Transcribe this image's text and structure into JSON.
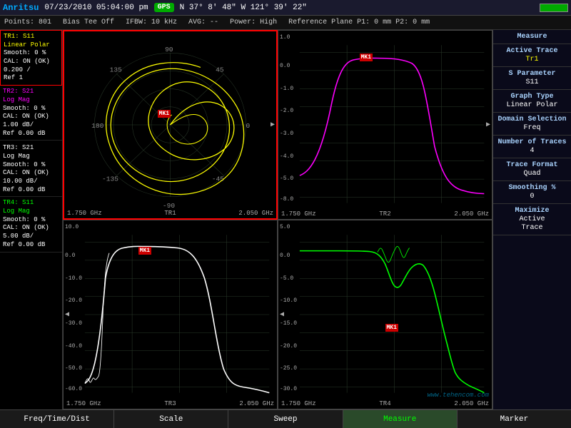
{
  "header": {
    "logo": "Anritsu",
    "datetime": "07/23/2010  05:04:00 pm",
    "gps": "GPS",
    "coords": "N 37° 8' 48\" W 121° 39' 22\"",
    "battery_label": "battery"
  },
  "subheader": {
    "points": "Points: 801",
    "bias_tee": "Bias Tee Off",
    "ifbw": "IFBW: 10 kHz",
    "avg": "AVG: --",
    "power": "Power: High",
    "ref_plane": "Reference Plane P1: 0 mm  P2: 0 mm"
  },
  "traces": [
    {
      "id": "TR1",
      "param": "S11",
      "type": "Linear Polar",
      "smooth": "Smooth: 0 %",
      "cal": "CAL: ON (OK)",
      "scale": "0.200 /",
      "ref": "Ref 1",
      "color": "tr1-color",
      "active": true
    },
    {
      "id": "TR2",
      "param": "S21",
      "type": "Log Mag",
      "smooth": "Smooth: 0 %",
      "cal": "CAL: ON (OK)",
      "scale": "1.00 dB/",
      "ref": "Ref 0.00 dB",
      "color": "tr2-color",
      "active": false
    },
    {
      "id": "TR3",
      "param": "S21",
      "type": "Log Mag",
      "smooth": "Smooth: 0 %",
      "cal": "CAL: ON (OK)",
      "scale": "10.00 dB/",
      "ref": "Ref 0.00 dB",
      "color": "tr3-color",
      "active": false
    },
    {
      "id": "TR4",
      "param": "S11",
      "type": "Log Mag",
      "smooth": "Smooth: 0 %",
      "cal": "CAL: ON (OK)",
      "scale": "5.00 dB/",
      "ref": "Ref 0.00 dB",
      "color": "tr4-color",
      "active": false
    }
  ],
  "graphs": [
    {
      "id": "TR1",
      "freq_start": "1.750 GHz",
      "freq_end": "2.050 GHz",
      "label": "TR1",
      "active": true
    },
    {
      "id": "TR2",
      "freq_start": "1.750 GHz",
      "freq_end": "2.050 GHz",
      "label": "TR2",
      "active": false
    },
    {
      "id": "TR3",
      "freq_start": "1.750 GHz",
      "freq_end": "2.050 GHz",
      "label": "TR3",
      "active": false
    },
    {
      "id": "TR4",
      "freq_start": "1.750 GHz",
      "freq_end": "2.050 GHz",
      "label": "TR4",
      "active": false
    }
  ],
  "sidebar": {
    "measure_title": "Measure",
    "active_trace_title": "Active Trace",
    "active_trace_value": "Tr1",
    "s_param_title": "S Parameter",
    "s_param_value": "S11",
    "graph_type_title": "Graph Type",
    "graph_type_value": "Linear Polar",
    "domain_title": "Domain Selection",
    "domain_value": "Freq",
    "num_traces_title": "Number of Traces",
    "num_traces_value": "4",
    "trace_format_title": "Trace Format",
    "trace_format_value": "Quad",
    "smoothing_title": "Smoothing %",
    "smoothing_value": "0",
    "maximize_title": "Maximize",
    "maximize_value": "Active",
    "trace_value": "Trace"
  },
  "bottom_tabs": [
    {
      "label": "Freq/Time/Dist",
      "active": false
    },
    {
      "label": "Scale",
      "active": false
    },
    {
      "label": "Sweep",
      "active": false
    },
    {
      "label": "Measure",
      "active": true
    },
    {
      "label": "Marker",
      "active": false
    }
  ],
  "watermark": "www.tehencom.com"
}
